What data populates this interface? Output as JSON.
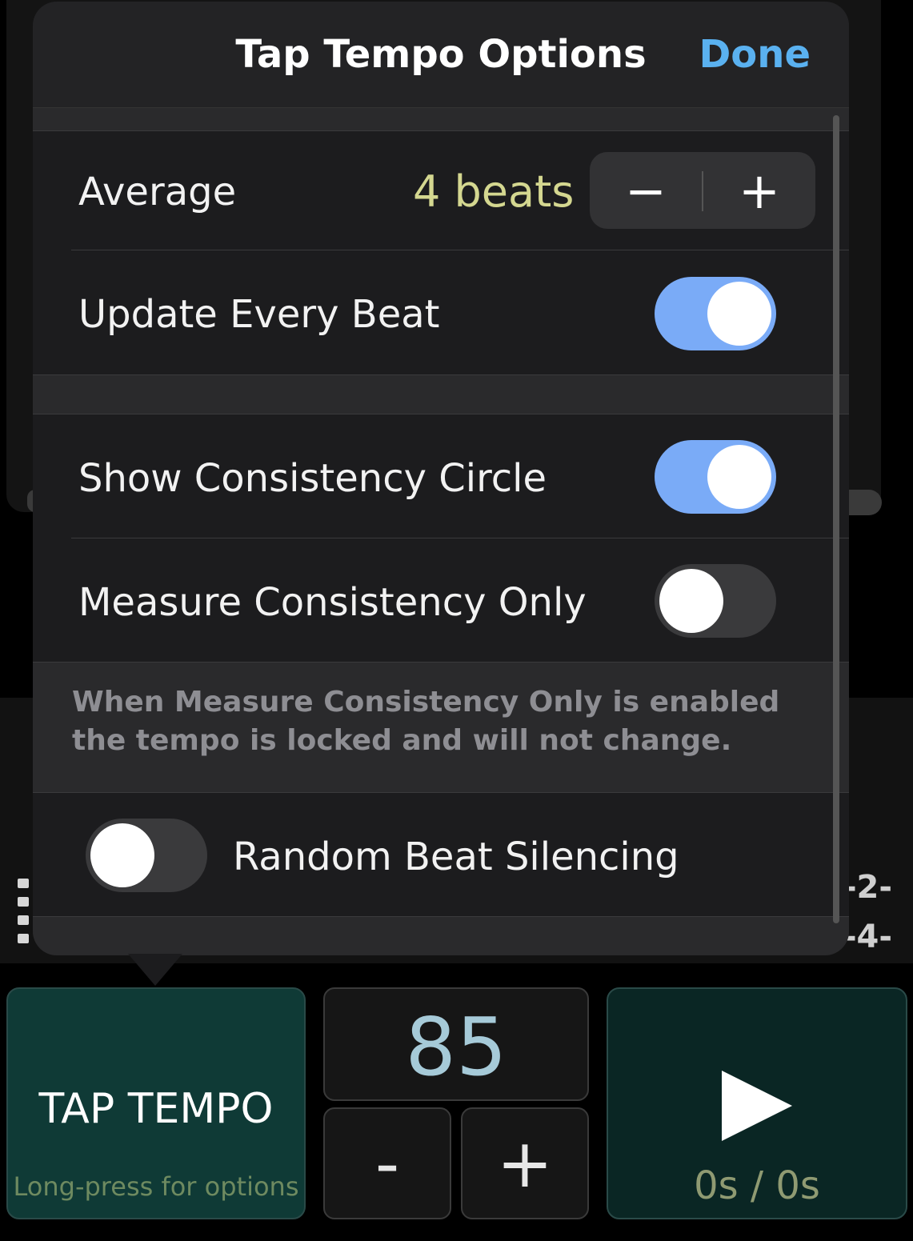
{
  "popover": {
    "title": "Tap Tempo Options",
    "done_label": "Done",
    "average": {
      "label": "Average",
      "value": "4 beats",
      "minus": "−",
      "plus": "+"
    },
    "update_every_beat": {
      "label": "Update Every Beat",
      "on": true
    },
    "show_consistency_circle": {
      "label": "Show Consistency Circle",
      "on": true
    },
    "measure_consistency_only": {
      "label": "Measure Consistency Only",
      "on": false
    },
    "note": "When Measure Consistency Only is enabled the tempo is locked and will not change.",
    "random_beat_silencing": {
      "label": "Random Beat Silencing",
      "on": false
    }
  },
  "background": {
    "beat_labels": [
      "-2-",
      "-4-"
    ]
  },
  "controls": {
    "tap_tempo": {
      "title": "TAP TEMPO",
      "subtitle": "Long-press for options"
    },
    "bpm": {
      "value": "85",
      "minus": "-",
      "plus": "+"
    },
    "play": {
      "time": "0s / 0s"
    }
  },
  "colors": {
    "accent": "#5ab1f0",
    "toggle_on": "#7aabf7",
    "value": "#d4d790"
  }
}
